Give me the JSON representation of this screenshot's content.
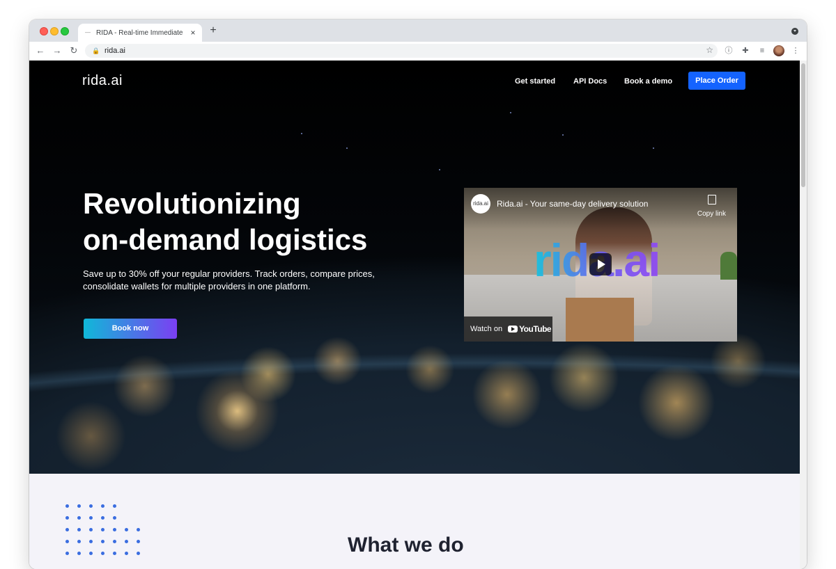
{
  "browser": {
    "tab_title": "RIDA - Real-time Immediate De",
    "tab_favicon_icon": "dash-icon",
    "tab_close": "×",
    "new_tab": "+",
    "address": "rida.ai",
    "icons": [
      "back-icon",
      "forward-icon",
      "reload-icon",
      "lock-icon",
      "star-icon",
      "extension-1password-icon",
      "extensions-puzzle-icon",
      "media-queue-icon",
      "profile-avatar",
      "menu-dots-icon"
    ]
  },
  "nav": {
    "brand": "rida.ai",
    "links": [
      "Get started",
      "API Docs",
      "Book a demo"
    ],
    "cta": "Place Order",
    "cta_color": "#1463ff"
  },
  "hero": {
    "headline_line1": "Revolutionizing",
    "headline_line2": "on-demand logistics",
    "subtext_line1": "Save up to 30% off your regular providers. Track orders, compare prices,",
    "subtext_line2": "consolidate wallets for multiple providers in one platform.",
    "button": "Book now",
    "button_gradient": [
      "#10b8d8",
      "#7b3ff2"
    ]
  },
  "video": {
    "channel_badge": "rida.ai",
    "title": "Rida.ai - Your same-day delivery solution",
    "copy_label": "Copy link",
    "watermark": "rida.ai",
    "watch_label": "Watch on",
    "platform": "YouTube"
  },
  "section": {
    "title": "What we do",
    "dot_color": "#3a6de0"
  }
}
